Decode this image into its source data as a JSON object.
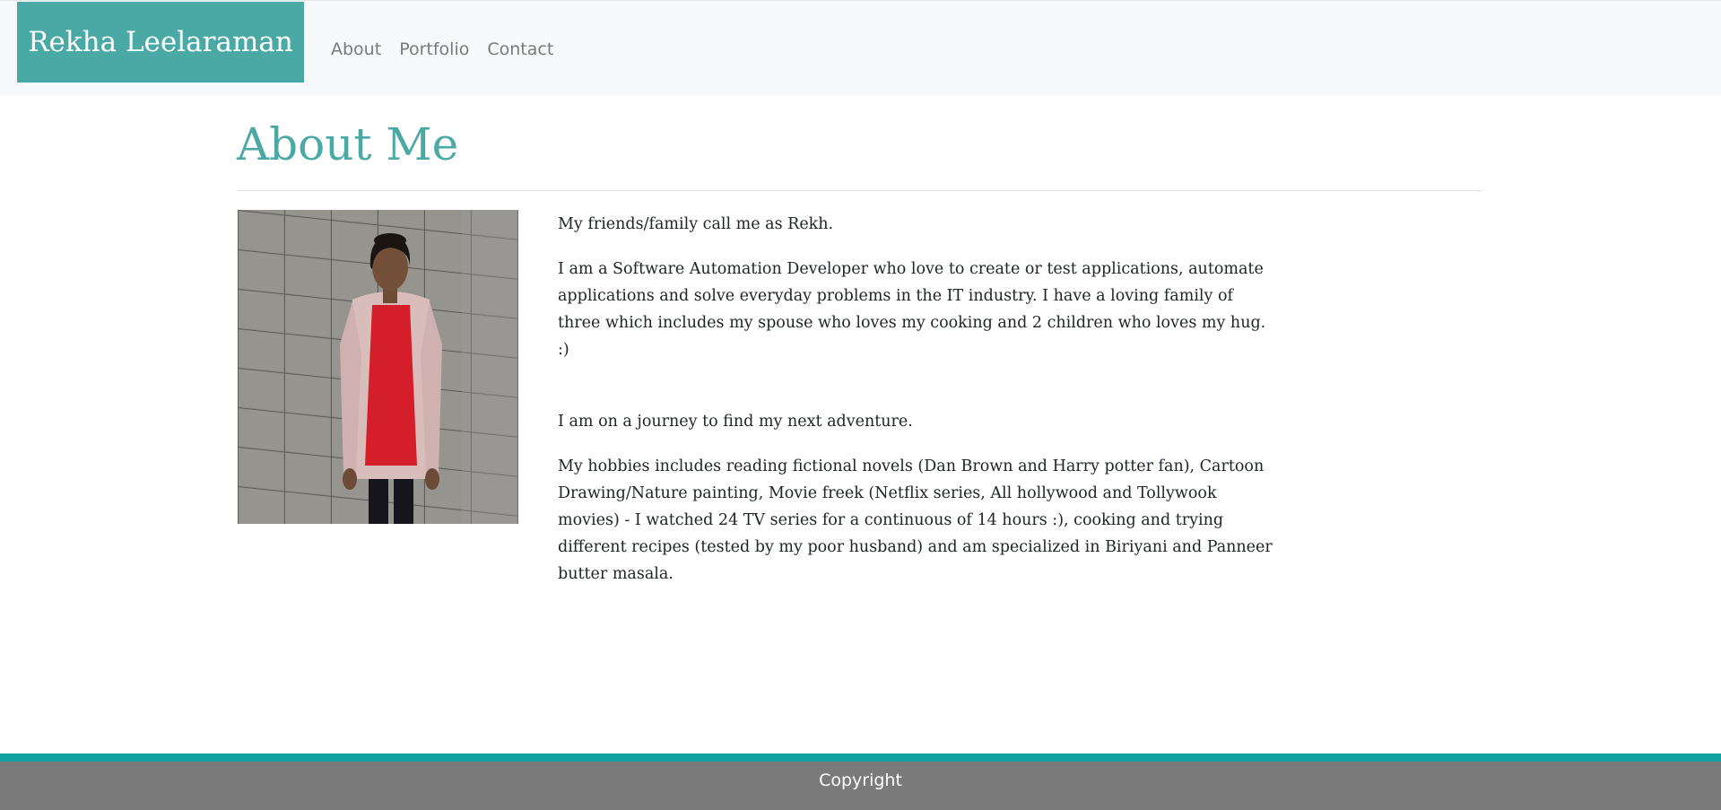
{
  "navbar": {
    "brand": "Rekha Leelaraman",
    "links": [
      "About",
      "Portfolio",
      "Contact"
    ]
  },
  "main": {
    "title": "About Me",
    "photo": {
      "alt": "Photo of Rekha Leelaraman"
    },
    "paragraphs": [
      "My friends/family call me as Rekh.",
      "I am a Software Automation Developer who love to create or test applications, automate applications and solve everyday problems in the IT industry. I have a loving family of three which includes my spouse who loves my cooking and 2 children who loves my hug. :)",
      "I am on a journey to find my next adventure.",
      "My hobbies includes reading fictional novels (Dan Brown and Harry potter fan), Cartoon Drawing/Nature painting, Movie freek (Netflix series, All hollywood and Tollywook movies) - I watched 24 TV series for a continuous of 14 hours :), cooking and trying different recipes (tested by my poor husband) and am specialized in Biriyani and Panneer butter masala."
    ]
  },
  "footer": {
    "text": "Copyright"
  },
  "colors": {
    "accent": "#4aa9a4",
    "footer_accent": "#12a39e",
    "footer_bg": "#7a7a7a",
    "navbar_bg": "#f8f9fa"
  }
}
